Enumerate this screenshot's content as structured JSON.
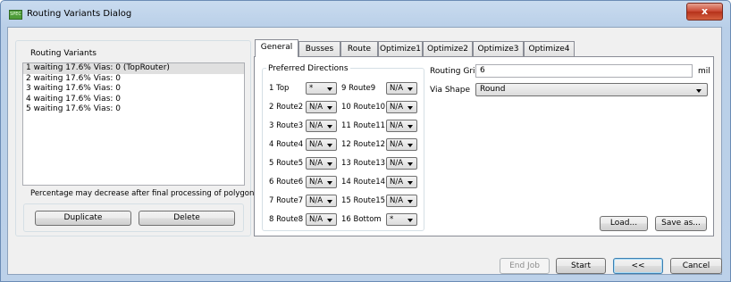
{
  "window": {
    "title": "Routing Variants Dialog",
    "close_glyph": "x",
    "app_icon_text": "SPEC"
  },
  "variants": {
    "label": "Routing Variants",
    "items": [
      "1 waiting  17.6%  Vias: 0 (TopRouter)",
      "2 waiting  17.6%  Vias: 0",
      "3 waiting  17.6%  Vias: 0",
      "4 waiting  17.6%  Vias: 0",
      "5 waiting  17.6%  Vias: 0"
    ],
    "note": "Percentage may decrease after final processing of polygons.",
    "duplicate_label": "Duplicate",
    "delete_label": "Delete"
  },
  "tabs": [
    "General",
    "Busses",
    "Route",
    "Optimize1",
    "Optimize2",
    "Optimize3",
    "Optimize4"
  ],
  "general": {
    "preferred_directions_label": "Preferred Directions",
    "left_layers": [
      {
        "layer": "1 Top",
        "value": "*"
      },
      {
        "layer": "2 Route2",
        "value": "N/A"
      },
      {
        "layer": "3 Route3",
        "value": "N/A"
      },
      {
        "layer": "4 Route4",
        "value": "N/A"
      },
      {
        "layer": "5 Route5",
        "value": "N/A"
      },
      {
        "layer": "6 Route6",
        "value": "N/A"
      },
      {
        "layer": "7 Route7",
        "value": "N/A"
      },
      {
        "layer": "8 Route8",
        "value": "N/A"
      }
    ],
    "right_layers": [
      {
        "layer": "9 Route9",
        "value": "N/A"
      },
      {
        "layer": "10 Route10",
        "value": "N/A"
      },
      {
        "layer": "11 Route11",
        "value": "N/A"
      },
      {
        "layer": "12 Route12",
        "value": "N/A"
      },
      {
        "layer": "13 Route13",
        "value": "N/A"
      },
      {
        "layer": "14 Route14",
        "value": "N/A"
      },
      {
        "layer": "15 Route15",
        "value": "N/A"
      },
      {
        "layer": "16 Bottom",
        "value": "*"
      }
    ],
    "routing_grid_label": "Routing Grid",
    "routing_grid_value": "6",
    "routing_grid_unit": "mil",
    "via_shape_label": "Via Shape",
    "via_shape_value": "Round",
    "load_label": "Load...",
    "save_as_label": "Save as..."
  },
  "footer": {
    "end_job_label": "End Job",
    "start_label": "Start",
    "back_label": "<<",
    "cancel_label": "Cancel"
  }
}
